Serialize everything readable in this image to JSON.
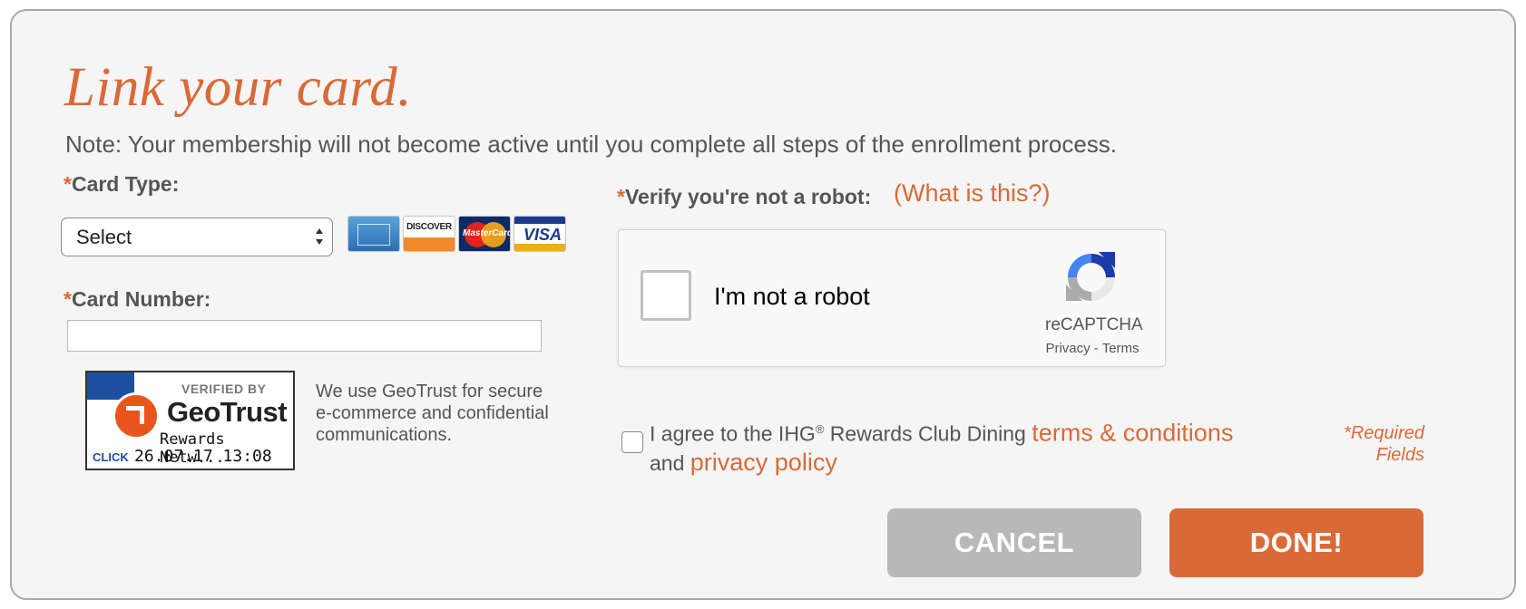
{
  "heading": {
    "title": "Link your card.",
    "note": "Note: Your membership will not become active until you complete all steps of the enrollment process."
  },
  "required_marker": "*",
  "card_type": {
    "label": "Card Type:",
    "selected": "Select",
    "logos": [
      "amex-logo",
      "discover-logo",
      "mastercard-logo",
      "visa-logo"
    ],
    "discover_text": "DISCOVER",
    "mastercard_text": "MasterCard",
    "visa_text": "VISA"
  },
  "card_number": {
    "label": "Card Number:",
    "value": ""
  },
  "geotrust": {
    "seal_verified": "VERIFIED BY",
    "seal_name": "GeoTrust",
    "seal_sub": "Rewards Netw...",
    "seal_click": "CLICK",
    "seal_date": "26.07.17 13:08 UT",
    "text": "We use GeoTrust for secure e-commerce and confidential communications."
  },
  "captcha": {
    "label": "Verify you're not a robot:",
    "help_link": "(What is this?)",
    "checkbox_label": "I'm not a robot",
    "brand": "reCAPTCHA",
    "privacy": "Privacy",
    "separator": " - ",
    "terms": "Terms"
  },
  "agreement": {
    "prefix": "I agree to the IHG",
    "registered": "®",
    "middle": " Rewards Club Dining ",
    "terms_link": "terms & conditions",
    "and": "and ",
    "privacy_link": "privacy policy"
  },
  "required_note": {
    "line1": "*Required",
    "line2": "Fields"
  },
  "buttons": {
    "cancel": "CANCEL",
    "done": "DONE!"
  },
  "colors": {
    "accent": "#d96a38",
    "panel_bg": "#f5f5f5",
    "cancel_bg": "#b8b8b8"
  }
}
